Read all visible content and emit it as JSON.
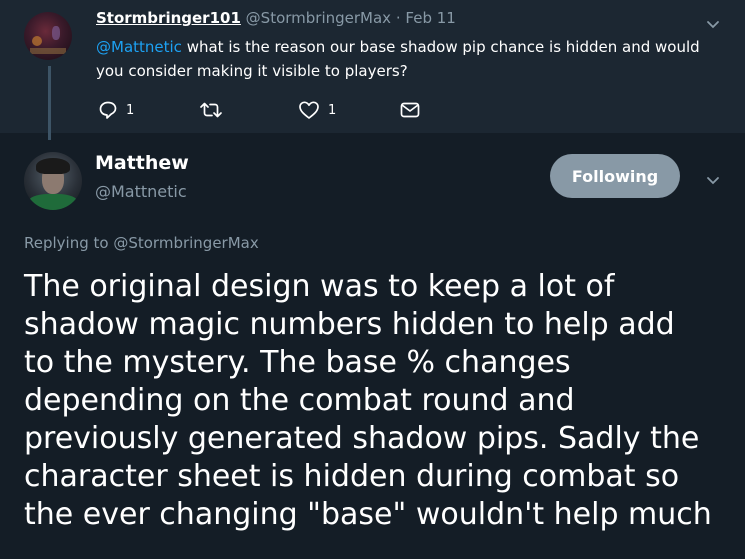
{
  "parent": {
    "name": "Stormbringer101",
    "handle": "@StormbringerMax",
    "separator": "·",
    "date": "Feb 11",
    "mention": "@Mattnetic",
    "text": " what is the reason our base shadow pip chance is hidden and would you consider making it visible to players?",
    "reply_count": "1",
    "like_count": "1"
  },
  "tweet": {
    "name": "Matthew",
    "handle": "@Mattnetic",
    "follow_label": "Following",
    "replying_prefix": "Replying to ",
    "replying_handle": "@StormbringerMax",
    "lines": [
      "The original design was to keep a lot of",
      "shadow magic numbers hidden to help add",
      "to the mystery. The base % changes",
      "depending on the combat round and",
      "previously generated shadow pips. Sadly the",
      "character sheet is hidden during combat so",
      "the ever changing \"base\" wouldn't help much"
    ]
  },
  "icons": [
    "chevron-down-icon",
    "reply-icon",
    "retweet-icon",
    "heart-icon",
    "dm-icon"
  ],
  "colors": {
    "background": "#141d26",
    "parent_background": "#1c2732",
    "muted": "#8899a6",
    "link": "#1da1f2"
  }
}
